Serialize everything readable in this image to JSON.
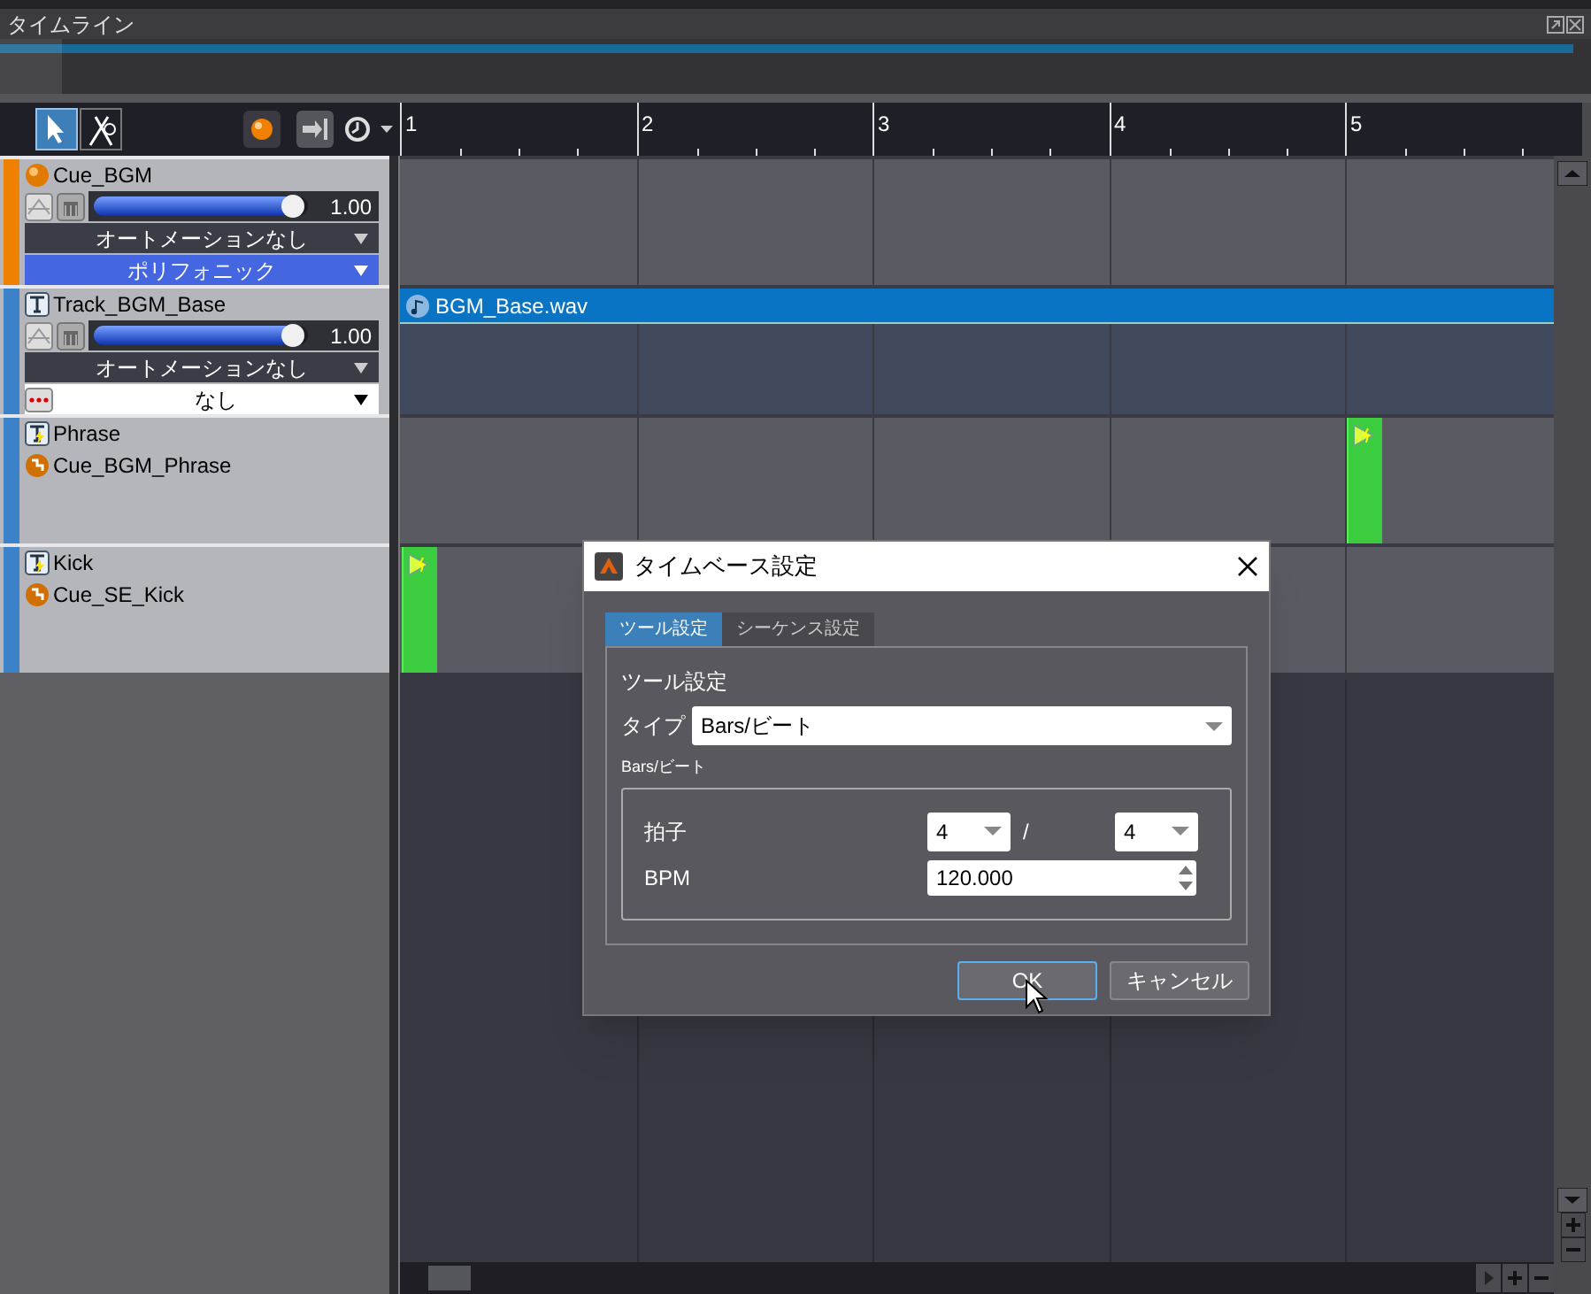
{
  "panel": {
    "title": "タイムライン"
  },
  "toolbar": {
    "tools": [
      {
        "kind": "select",
        "selected": true
      },
      {
        "kind": "cut",
        "selected": false
      }
    ]
  },
  "ruler": [
    "1",
    "2",
    "3",
    "4",
    "5"
  ],
  "tracks": [
    {
      "kind": "cue",
      "name": "Cue_BGM",
      "color": "#f08000",
      "level": 0.93,
      "reading": "1.00",
      "automation": "オートメーションなし",
      "mode": {
        "kind": "blue",
        "label": "ポリフォニック"
      }
    },
    {
      "kind": "track",
      "name": "Track_BGM_Base",
      "color": "#3c82c8",
      "level": 0.93,
      "reading": "1.00",
      "automation": "オートメーションなし",
      "mode": {
        "kind": "white",
        "label": "なし"
      },
      "clip": "BGM_Base.wav"
    },
    {
      "kind": "trigger",
      "name": "Phrase",
      "color": "#3c82c8",
      "cue": "Cue_BGM_Phrase",
      "bars": [
        {
          "trigger": false
        },
        {
          "trigger": false
        },
        {
          "trigger": false
        },
        {
          "trigger": false
        },
        {
          "trigger": true
        }
      ]
    },
    {
      "kind": "trigger",
      "name": "Kick",
      "color": "#3c82c8",
      "cue": "Cue_SE_Kick",
      "bars": [
        {
          "trigger": true
        },
        {
          "trigger": false
        },
        {
          "trigger": false
        },
        {
          "trigger": false
        },
        {
          "trigger": false
        }
      ]
    }
  ],
  "dialog": {
    "title": "タイムベース設定",
    "tabs": [
      {
        "label": "ツール設定",
        "selected": true
      },
      {
        "label": "シーケンス設定",
        "selected": false
      }
    ],
    "section": "ツール設定",
    "type_label": "タイプ",
    "type_value": "Bars/ビート",
    "group": "Bars/ビート",
    "meter_label": "拍子",
    "numerator": "4",
    "slash": "/",
    "denominator": "4",
    "bpm_label": "BPM",
    "bpm": "120.000",
    "buttons": [
      {
        "label": "OK",
        "focused": true
      },
      {
        "label": "キャンセル",
        "focused": false
      }
    ]
  }
}
